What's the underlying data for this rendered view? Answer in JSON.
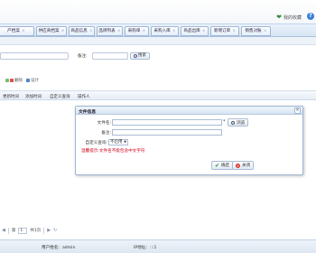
{
  "header": {
    "favorites_label": "我的收藏",
    "favorites_icon": "star-icon",
    "help_icon": "question-icon"
  },
  "tabs": [
    {
      "label": "产档案"
    },
    {
      "label": "供应商档案"
    },
    {
      "label": "商品信息"
    },
    {
      "label": "品牌列表"
    },
    {
      "label": "采购单"
    },
    {
      "label": "采购入库"
    },
    {
      "label": "商品出库"
    },
    {
      "label": "新增订单"
    },
    {
      "label": "销售对账"
    }
  ],
  "search": {
    "remark_label": "备注:",
    "search_button": "搜索"
  },
  "toolbar": {
    "delete_label": "删除",
    "design_label": "设计"
  },
  "table": {
    "columns": [
      "更新时间",
      "添加时间",
      "自定义查询",
      "操作人"
    ]
  },
  "pager": {
    "page_label": "第",
    "page_value": "1",
    "total_label": "共1页"
  },
  "status": {
    "username": "用户姓名：admin",
    "ip": "IP地址：:::1"
  },
  "dialog": {
    "title": "文件信息",
    "filename_label": "文件名:",
    "required_mark": "*",
    "browse_button": "浏览",
    "remark_label": "备注:",
    "custom_query_label": "自定义查询:",
    "custom_query_value": "不启用",
    "warning": "温馨提示:文件名不能包含中文字符",
    "ok_button": "确定",
    "close_button": "关闭"
  },
  "colors": {
    "accent": "#3b7dd8",
    "warning": "#d0021b",
    "tab_border": "#9fb7d6"
  }
}
